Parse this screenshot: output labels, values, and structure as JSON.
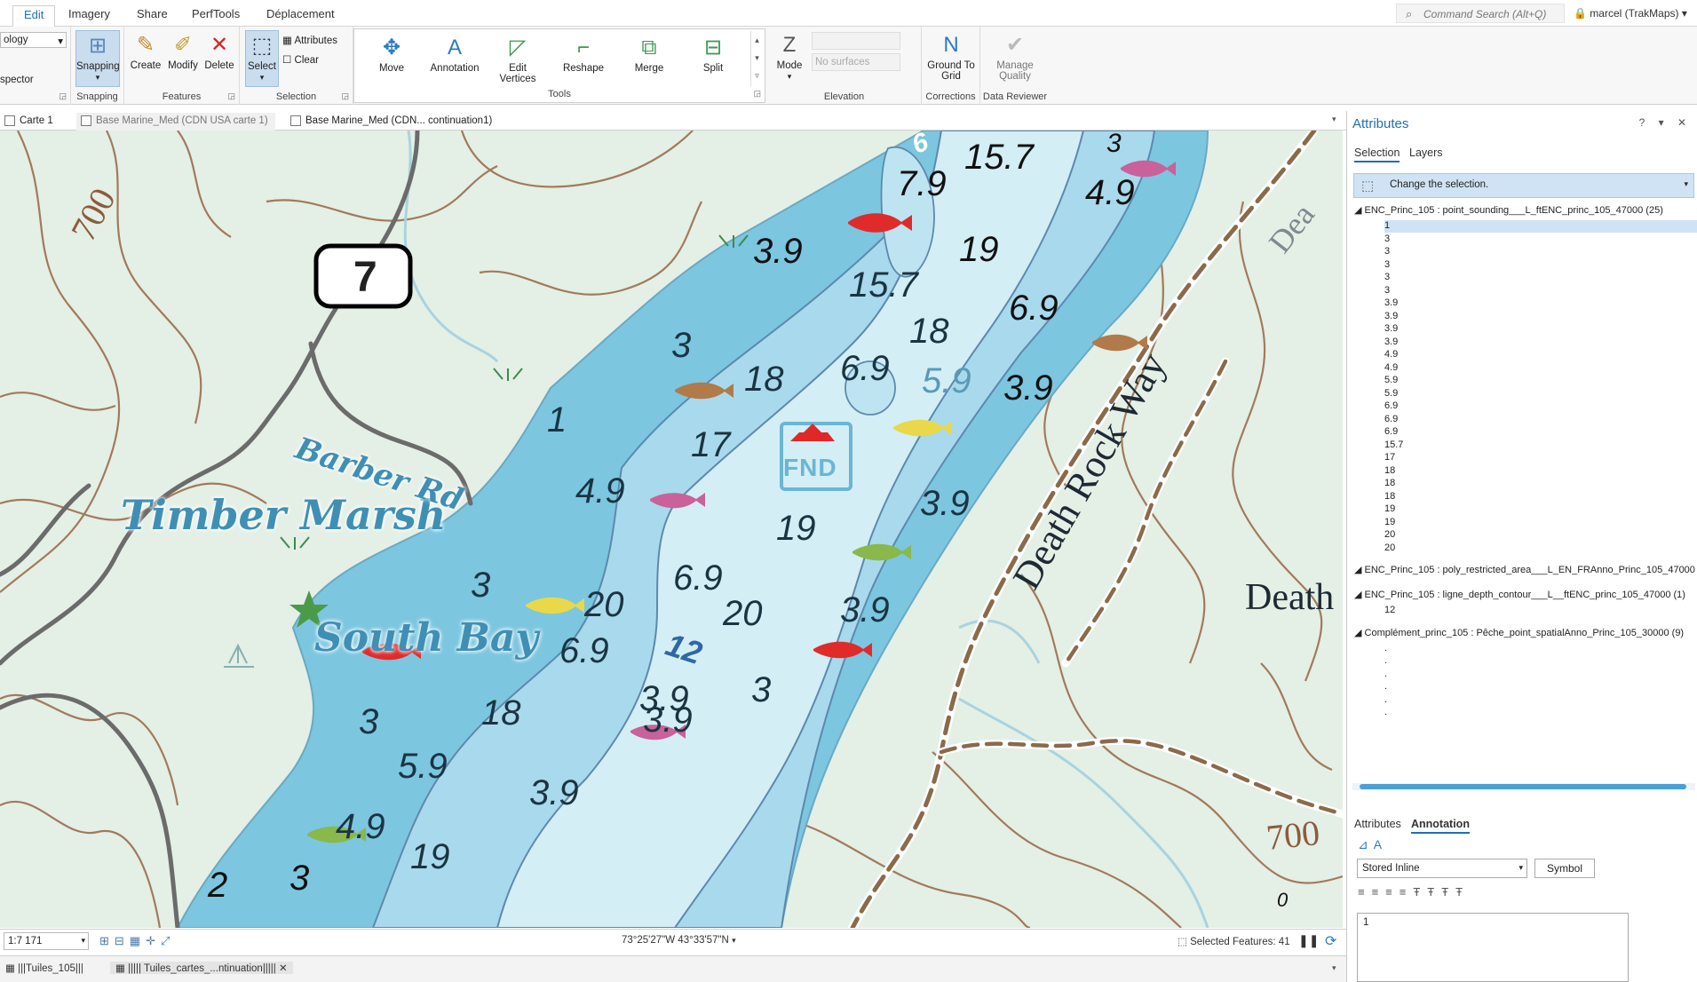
{
  "ribbon_tabs": [
    "Edit",
    "Imagery",
    "Share",
    "PerfTools",
    "Déplacement"
  ],
  "search_placeholder": "Command Search (Alt+Q)",
  "user_name": "marcel (TrakMaps)",
  "ribbon": {
    "left_dropdown": "ology",
    "left_label": "spector",
    "snapping": "Snapping",
    "snapping_group": "Snapping",
    "create": "Create",
    "modify": "Modify",
    "delete": "Delete",
    "features_group": "Features",
    "select": "Select",
    "attributes": "Attributes",
    "clear": "Clear",
    "selection_group": "Selection",
    "move": "Move",
    "annotation": "Annotation",
    "edit_vertices": "Edit Vertices",
    "reshape": "Reshape",
    "merge": "Merge",
    "split": "Split",
    "tools_group": "Tools",
    "mode": "Mode",
    "no_surfaces": "No surfaces",
    "elevation_group": "Elevation",
    "ground_to_grid": "Ground To Grid",
    "corrections_group": "Corrections",
    "manage_quality": "Manage Quality",
    "data_reviewer_group": "Data Reviewer"
  },
  "view_tabs": [
    "Carte 1",
    "Base Marine_Med (CDN USA carte 1)",
    "Base Marine_Med (CDN... continuation1)"
  ],
  "map": {
    "places": {
      "timber_marsh": "Timber Marsh",
      "south_bay": "South Bay",
      "barber_rd": "Barber Rd",
      "death_rock_way": "Death Rock Way",
      "death": "Death",
      "dea": "Dea"
    },
    "route_shield": "7",
    "contour_labels": [
      "700",
      "700"
    ],
    "fnd_label": "FND",
    "depths": [
      "15.7",
      "7.9",
      "19",
      "15.7",
      "18",
      "6.9",
      "3.9",
      "3",
      "3.9",
      "4.9",
      "6.9",
      "18",
      "5.9",
      "3.9",
      "17",
      "1",
      "4.9",
      "19",
      "3.9",
      "3",
      "6.9",
      "20",
      "20",
      "3.9",
      "12",
      "6.9",
      "3",
      "18",
      "3",
      "3.9",
      "5.9",
      "3.9",
      "4.9",
      "19",
      "2",
      "3",
      "3",
      "6",
      "0"
    ]
  },
  "status": {
    "scale": "1:7 171",
    "coords": "73°25'27\"W 43°33'57\"N",
    "selected_features": "Selected Features: 41"
  },
  "bottom_tabs": [
    "|||Tuiles_105|||",
    "||||| Tuiles_cartes_...ntinuation|||||"
  ],
  "pane": {
    "title": "Attributes",
    "controls": "? ▾ ✕",
    "tabs": [
      "Selection",
      "Layers"
    ],
    "change_selection": "Change the selection.",
    "layers": [
      {
        "name": "ENC_Princ_105 : point_sounding___L_ftENC_princ_105_47000 (25)",
        "items": [
          "1",
          "3",
          "3",
          "3",
          "3",
          "3",
          "3.9",
          "3.9",
          "3.9",
          "3.9",
          "4.9",
          "4.9",
          "5.9",
          "5.9",
          "6.9",
          "6.9",
          "6.9",
          "15.7",
          "17",
          "18",
          "18",
          "18",
          "19",
          "19",
          "20",
          "20"
        ]
      },
      {
        "name": "ENC_Princ_105 : poly_restricted_area___L_EN_FRAnno_Princ_105_47000 (",
        "items": []
      },
      {
        "name": "ENC_Princ_105 : ligne_depth_contour___L__ftENC_princ_105_47000 (1)",
        "items": [
          "12"
        ]
      },
      {
        "name": "Complément_princ_105 : Pêche_point_spatialAnno_Princ_105_30000 (9)",
        "items": [
          ".",
          ".",
          ".",
          ".",
          ".",
          "."
        ]
      }
    ],
    "lower_tabs": [
      "Attributes",
      "Annotation"
    ],
    "stored": "Stored Inline",
    "symbol": "Symbol",
    "text_value": "1"
  }
}
